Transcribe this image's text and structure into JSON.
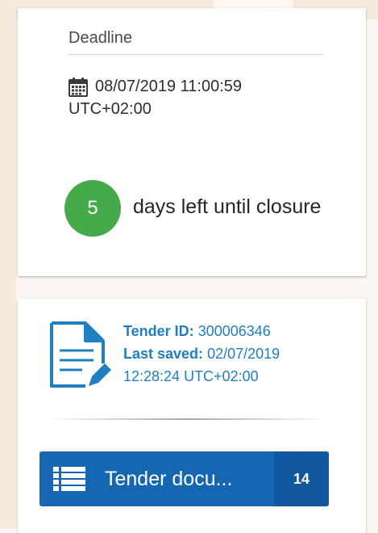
{
  "deadline": {
    "label": "Deadline",
    "date": "08/07/2019 11:00:59",
    "timezone": "UTC+02:00",
    "icon": "calendar-icon",
    "days_left": "5",
    "days_left_text": "days left until closure",
    "days_circle_color": "#46a94a"
  },
  "tender": {
    "id_label": "Tender ID:",
    "id_value": "300006346",
    "saved_label": "Last saved:",
    "saved_date": "02/07/2019",
    "saved_time": "12:28:24 UTC+02:00",
    "icon": "document-edit-icon",
    "accent_color": "#1f7fc1"
  },
  "documents_button": {
    "label": "Tender docu...",
    "count": "14",
    "icon": "list-icon",
    "color": "#1667b2"
  }
}
